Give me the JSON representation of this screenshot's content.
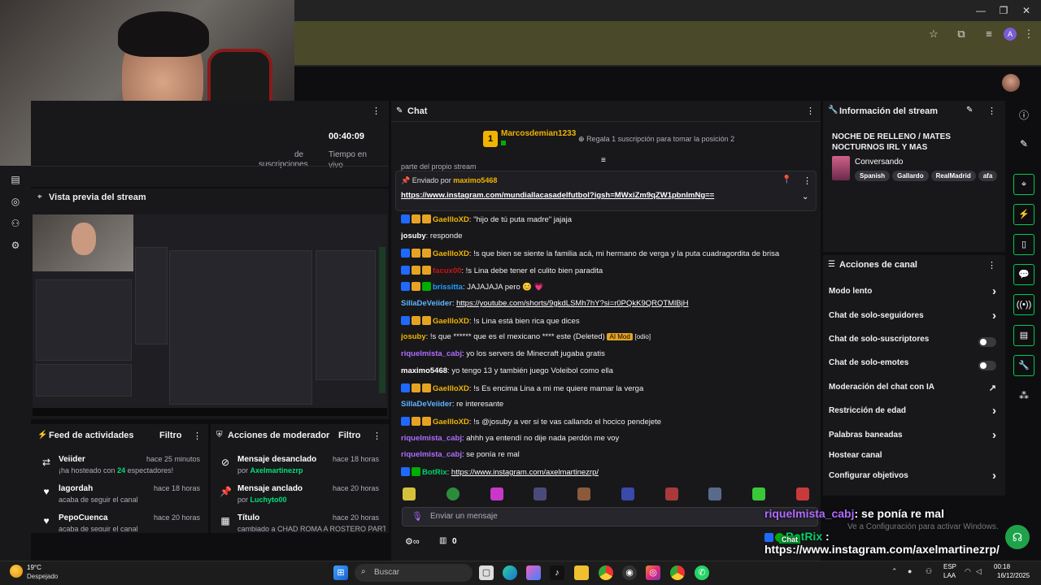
{
  "stats": {
    "time_value": "00:40:09",
    "time_label_1": "Tiempo en",
    "time_label_2": "vivo",
    "subs_label_1": "de",
    "subs_label_2": "suscripciones"
  },
  "preview": {
    "title": "Vista previa del stream"
  },
  "feed": {
    "title": "Feed de actividades",
    "filter": "Filtro",
    "items": [
      {
        "name": "Veiider",
        "sub_pre": "¡ha hosteado con ",
        "sub_num": "24",
        "sub_post": " espectadores!",
        "time": "hace 25 minutos"
      },
      {
        "name": "lagordah",
        "sub": "acaba de seguir el canal",
        "time": "hace 18 horas"
      },
      {
        "name": "PepoCuenca",
        "sub": "acaba de seguir el canal",
        "time": "hace 20 horas"
      }
    ]
  },
  "modact": {
    "title": "Acciones de moderador",
    "filter": "Filtro",
    "items": [
      {
        "name": "Mensaje desanclado",
        "by": "por",
        "user": "Axelmartinezrp",
        "time": "hace 18 horas"
      },
      {
        "name": "Mensaje anclado",
        "by": "por",
        "user": "Luchyto00",
        "time": "hace 20 horas"
      },
      {
        "name": "Título",
        "sub": "cambiado a CHAD ROMA A ROSTERO PARTE",
        "time": "hace 20 horas"
      }
    ]
  },
  "chat": {
    "title": "Chat",
    "hype_user": "Marcosdemian1233",
    "hype_count": "1",
    "gift_prompt": "Regala 1 suscripción para tomar la posición 2",
    "scroll_partial": "parte del propio stream",
    "pinned_by_label": "Enviado por",
    "pinned_by_user": "maximo5468",
    "pinned_link": "https://www.instagram.com/mundiallacasadelfutbol?igsh=MWxiZm9qZW1pbnImNg==",
    "input_placeholder": "Enviar un mensaje",
    "points": "0",
    "messages": [
      {
        "user": "GaellloXD",
        "color": "#f0b400",
        "text": ": \"hijo de tú puta madre\" jajaja"
      },
      {
        "user": "josuby",
        "color": "#ffffff",
        "text": ": responde"
      },
      {
        "user": "GaellloXD",
        "color": "#f0b400",
        "text": ": !s que bien se siente la familia acá, mi hermano de verga y la puta cuadragordita de brisa"
      },
      {
        "user": "facux00",
        "color": "#c81414",
        "text": ": !s Lina debe tener el culito bien paradita"
      },
      {
        "user": "brissitta",
        "color": "#1f9fff",
        "text": ": JAJAJAJA pero 😊 💗"
      },
      {
        "user": "SillaDeVeiider",
        "color": "#5fb4ff",
        "text": ": ",
        "link": "https://youtube.com/shorts/9gkdLSMh7hY?si=r0PQkK9QRQTMlBjH"
      },
      {
        "user": "GaellloXD",
        "color": "#f0b400",
        "text": ": !s Lina está bien rica que dices"
      },
      {
        "user": "josuby",
        "color": "#f0b400",
        "text": ": !s que ****** que es el mexicano **** este (Deleted)",
        "ai": "AI Mod",
        "extra": "[odio]"
      },
      {
        "user": "riquelmista_cabj",
        "color": "#b06bff",
        "text": ": yo los servers de Minecraft jugaba gratis"
      },
      {
        "user": "maximo5468",
        "color": "#ffffff",
        "text": ": yo tengo 13 y también juego Voleibol como ella"
      },
      {
        "user": "GaellloXD",
        "color": "#f0b400",
        "text": ": !s Es encima Lina a mi me quiere mamar la verga"
      },
      {
        "user": "SillaDeVeiider",
        "color": "#5fb4ff",
        "text": ": re interesante"
      },
      {
        "user": "GaellloXD",
        "color": "#f0b400",
        "text": ": !s @josuby a ver si te vas callando el hocico pendejete"
      },
      {
        "user": "riquelmista_cabj",
        "color": "#b06bff",
        "text": ": ahhh ya entendí no dije nada perdón me voy"
      },
      {
        "user": "riquelmista_cabj",
        "color": "#b06bff",
        "text": ": se ponía re mal"
      },
      {
        "user": "BotRix",
        "color": "#00d26a",
        "text": ": ",
        "link": "https://www.instagram.com/axelmartinezrp/"
      }
    ]
  },
  "info": {
    "title": "Información del stream",
    "stream_title": "NOCHE DE RELLENO / MATES NOCTURNOS IRL Y MAS",
    "category": "Conversando",
    "tags": [
      "Spanish",
      "Gallardo",
      "RealMadrid",
      "afa"
    ]
  },
  "actions": {
    "title": "Acciones de canal",
    "rows": [
      {
        "label": "Modo lento",
        "kind": "arrow"
      },
      {
        "label": "Chat de solo-seguidores",
        "kind": "arrow"
      },
      {
        "label": "Chat de solo-suscriptores",
        "kind": "toggle"
      },
      {
        "label": "Chat de solo-emotes",
        "kind": "toggle"
      },
      {
        "label": "Moderación del chat con IA",
        "kind": "ext"
      },
      {
        "label": "Restricción de edad",
        "kind": "arrow"
      },
      {
        "label": "Palabras baneadas",
        "kind": "arrow"
      },
      {
        "label": "Hostear canal",
        "kind": "none"
      },
      {
        "label": "Configurar objetivos",
        "kind": "arrow"
      }
    ]
  },
  "overlay": {
    "user1": "riquelmista_cabj",
    "msg1": ": se ponía re mal",
    "user2": "BotRix",
    "msg2_sep": " :",
    "link2": "https://www.instagram.com/axelmartinezrp/",
    "chat_tag": "Chat",
    "activate": "Ve a Configuración para activar Windows."
  },
  "taskbar": {
    "weather_temp": "19°C",
    "weather_desc": "Despejado",
    "search_placeholder": "Buscar",
    "lang_1": "ESP",
    "lang_2": "LAA",
    "time": "00:18",
    "date": "16/12/2025"
  },
  "browser": {
    "profile_initial": "A"
  }
}
